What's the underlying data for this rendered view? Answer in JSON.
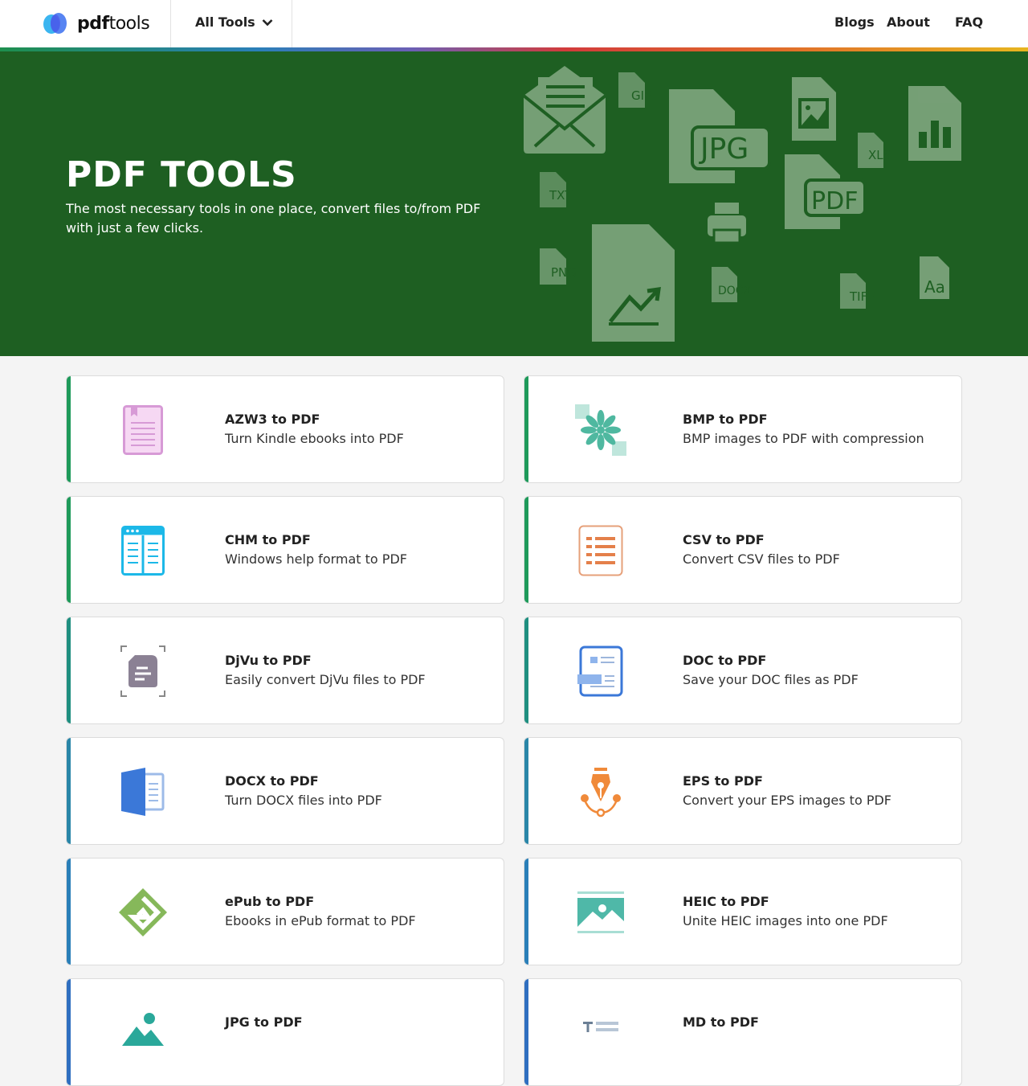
{
  "header": {
    "logo_bold": "pdf",
    "logo_light": "tools",
    "all_tools": "All Tools",
    "nav": [
      "Blogs",
      "About",
      "FAQ"
    ]
  },
  "hero": {
    "title": "PDF TOOLS",
    "subtitle": "The most necessary tools in one place, convert files to/from PDF with just a few clicks.",
    "file_badges": [
      "GIF",
      "JPG",
      "XLS",
      "TXT",
      "PDF",
      "PNG",
      "DOCX",
      "TIFF",
      "Aa"
    ],
    "background_color": "#1e5f22"
  },
  "tools": [
    {
      "title": "AZW3 to PDF",
      "desc": "Turn Kindle ebooks into PDF",
      "icon": "kindle-book-icon",
      "accent": "#1e9a5a"
    },
    {
      "title": "BMP to PDF",
      "desc": "BMP images to PDF with compression",
      "icon": "bmp-flower-icon",
      "accent": "#1e9a5a"
    },
    {
      "title": "CHM to PDF",
      "desc": "Windows help format to PDF",
      "icon": "chm-book-icon",
      "accent": "#1e9a5a"
    },
    {
      "title": "CSV to PDF",
      "desc": "Convert CSV files to PDF",
      "icon": "csv-list-icon",
      "accent": "#1e9a5a"
    },
    {
      "title": "DjVu to PDF",
      "desc": "Easily convert DjVu files to PDF",
      "icon": "djvu-doc-icon",
      "accent": "#1f8f80"
    },
    {
      "title": "DOC to PDF",
      "desc": "Save your DOC files as PDF",
      "icon": "doc-file-icon",
      "accent": "#1f8f80"
    },
    {
      "title": "DOCX to PDF",
      "desc": "Turn DOCX files into PDF",
      "icon": "docx-file-icon",
      "accent": "#2a86a8"
    },
    {
      "title": "EPS to PDF",
      "desc": "Convert your EPS images to PDF",
      "icon": "eps-pen-icon",
      "accent": "#2a86a8"
    },
    {
      "title": "ePub to PDF",
      "desc": "Ebooks in ePub format to PDF",
      "icon": "epub-icon",
      "accent": "#2a7fb8"
    },
    {
      "title": "HEIC to PDF",
      "desc": "Unite HEIC images into one PDF",
      "icon": "heic-image-icon",
      "accent": "#2a7fb8"
    },
    {
      "title": "JPG to PDF",
      "desc": "",
      "icon": "jpg-image-icon",
      "accent": "#2f6fc0"
    },
    {
      "title": "MD to PDF",
      "desc": "",
      "icon": "markdown-text-icon",
      "accent": "#2f6fc0"
    }
  ]
}
